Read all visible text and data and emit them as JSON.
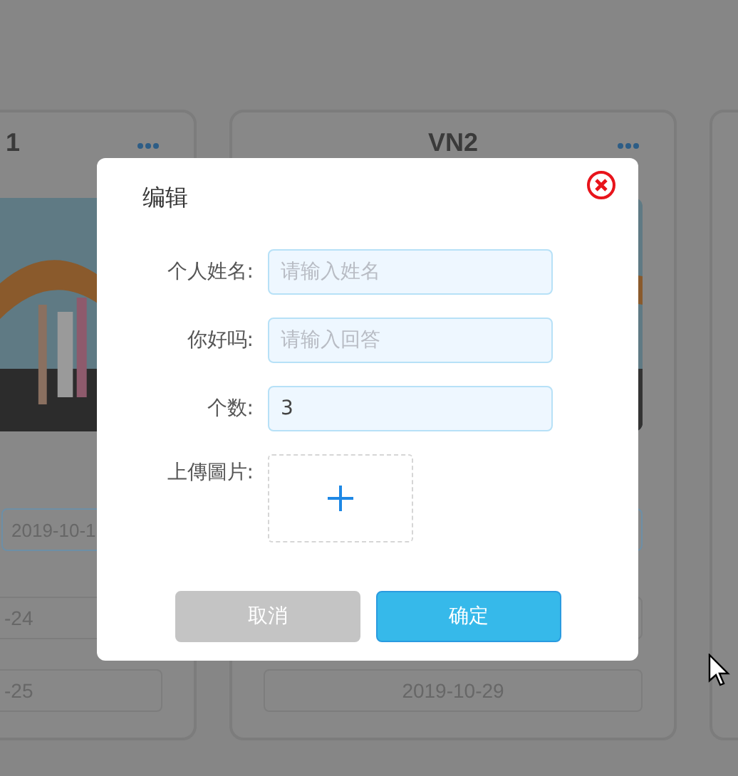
{
  "background_cards": [
    {
      "title": "1",
      "image": {
        "kind": "picture"
      },
      "dates": [
        {
          "text": "2019-10-1",
          "highlighted": true
        },
        {
          "text": "-24",
          "highlighted": false
        },
        {
          "text": "-25",
          "highlighted": false
        }
      ]
    },
    {
      "title": "VN2",
      "image": {
        "kind": "picture"
      },
      "dates": [
        {
          "highlighted": true
        },
        {
          "highlighted": false
        },
        {
          "text": "2019-10-29",
          "highlighted": false
        }
      ]
    }
  ],
  "dialog": {
    "title": "编辑",
    "fields": [
      {
        "kind": "text",
        "label": "个人姓名:",
        "placeholder": "请输入姓名"
      },
      {
        "kind": "text",
        "label": "你好吗:",
        "placeholder": "请输入回答"
      },
      {
        "kind": "text",
        "label": "个数:",
        "value": "3"
      },
      {
        "kind": "upload",
        "label": "上傳圖片:"
      }
    ],
    "buttons": [
      {
        "label": "取消",
        "kind": "cancel"
      },
      {
        "label": "确定",
        "kind": "primary"
      }
    ]
  }
}
